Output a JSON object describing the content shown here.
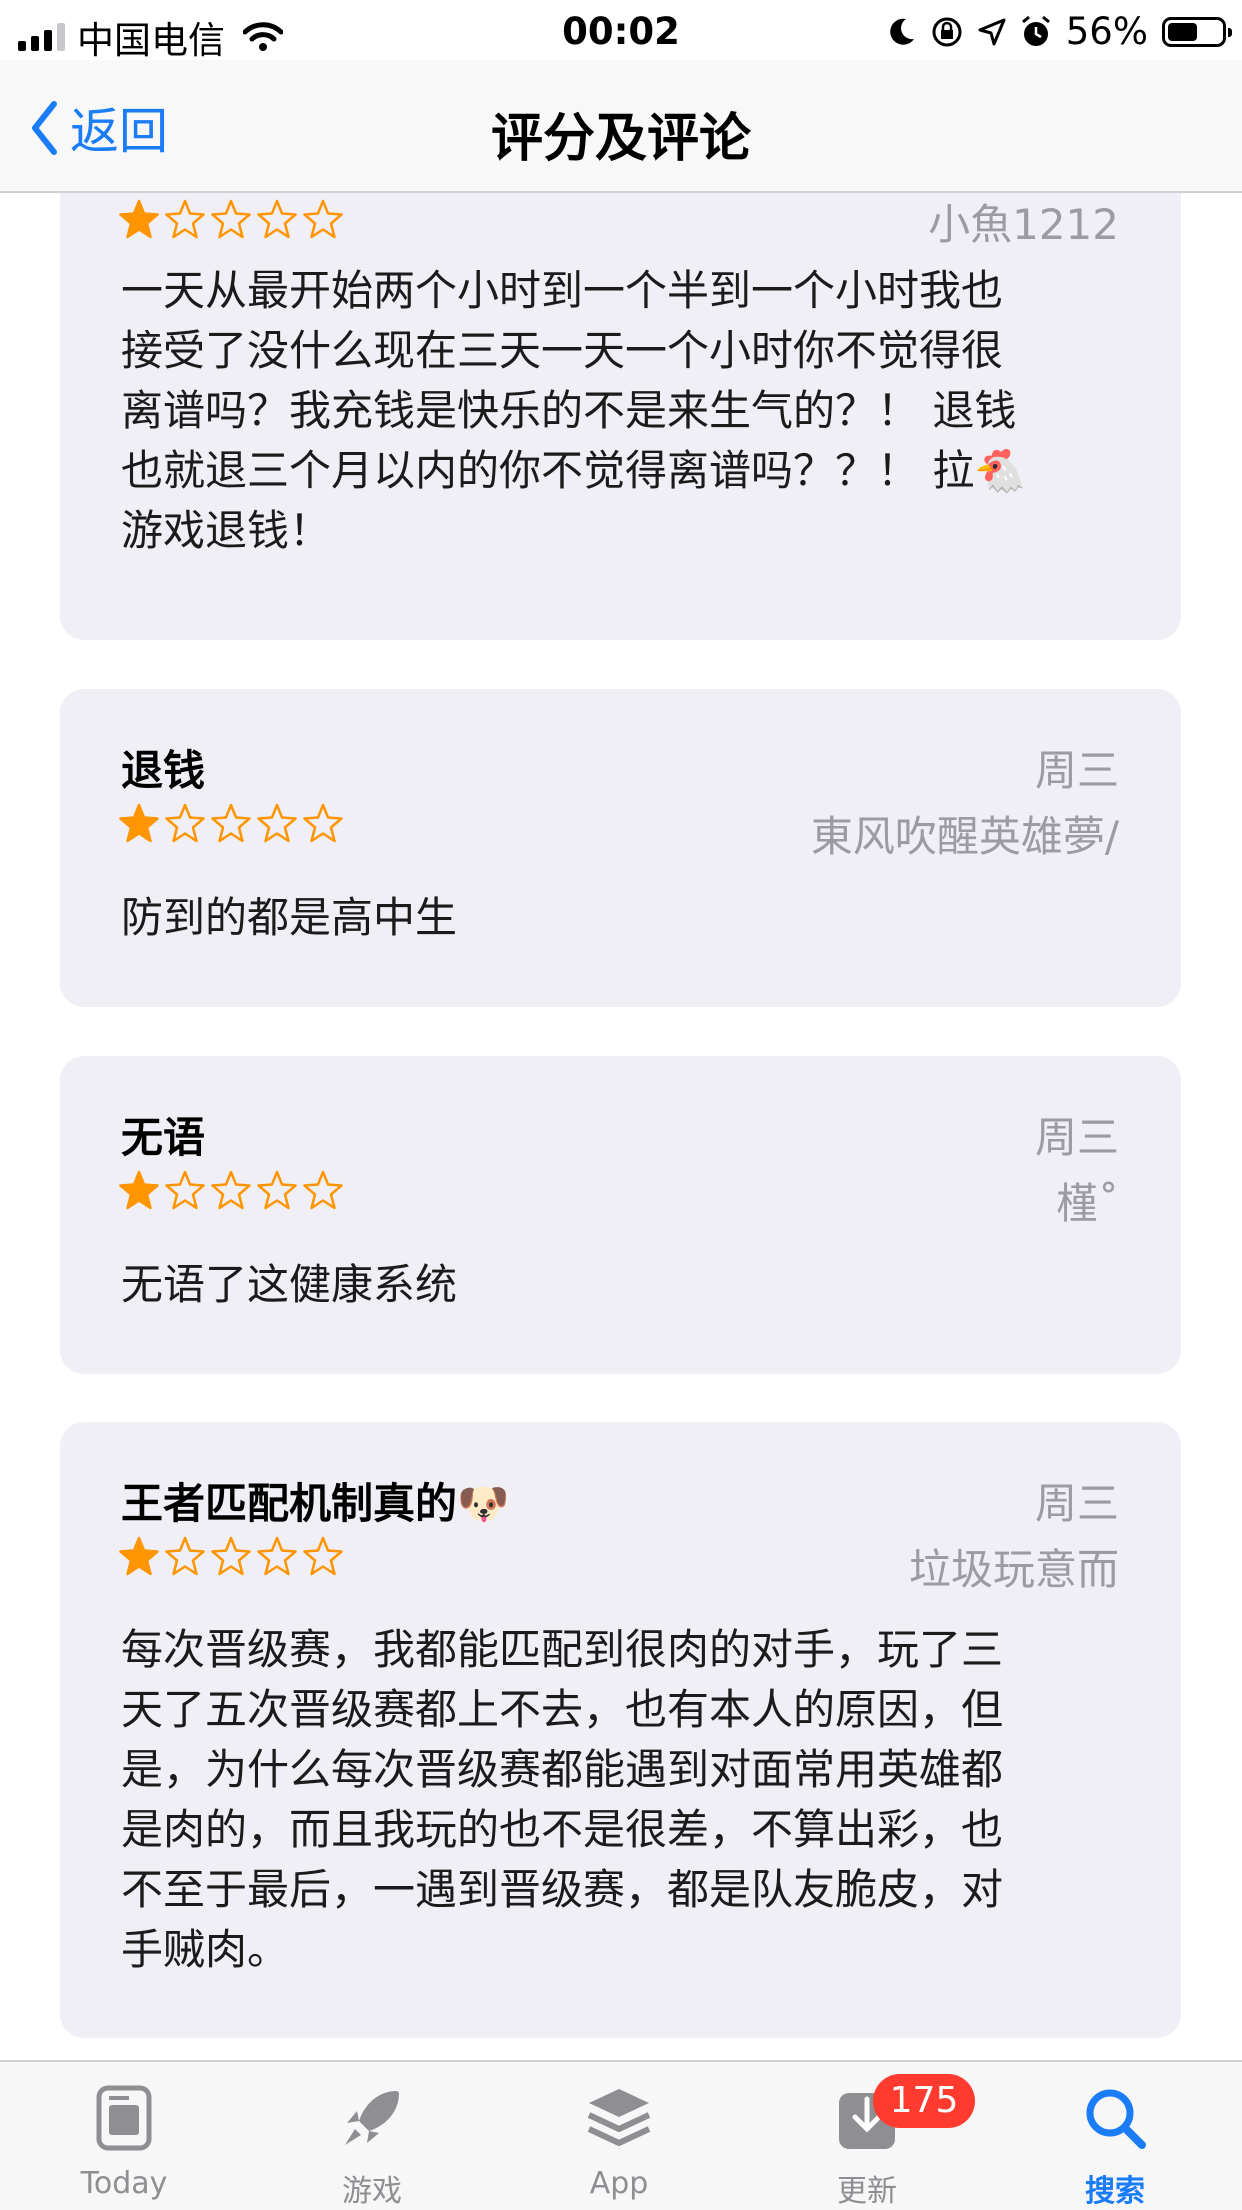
{
  "status_bar": {
    "carrier": "中国电信",
    "time": "00:02",
    "battery": "56%",
    "battery_level": 0.56
  },
  "nav": {
    "back_label": "返回",
    "title": "评分及评论"
  },
  "reviews": [
    {
      "title": "",
      "date": "",
      "author": "小魚1212",
      "rating": 1,
      "lines": [
        "一天从最开始两个小时到一个半到一个小时我也",
        "接受了没什么现在三天一天一个小时你不觉得很",
        "离谱吗？我充钱是快乐的不是来生气的？！ 退钱",
        "也就退三个月以内的你不觉得离谱吗？？！ 拉🐔",
        "游戏退钱！"
      ]
    },
    {
      "title": "退钱",
      "date": "周三",
      "author": "東风吹醒英雄夢/",
      "rating": 1,
      "lines": [
        "防到的都是高中生"
      ]
    },
    {
      "title": "无语",
      "date": "周三",
      "author": "槿˚",
      "rating": 1,
      "lines": [
        "无语了这健康系统"
      ]
    },
    {
      "title": "王者匹配机制真的🐶",
      "date": "周三",
      "author": "垃圾玩意而",
      "rating": 1,
      "lines": [
        "每次晋级赛，我都能匹配到很肉的对手，玩了三",
        "天了五次晋级赛都上不去，也有本人的原因，但",
        "是，为什么每次晋级赛都能遇到对面常用英雄都",
        "是肉的，而且我玩的也不是很差，不算出彩，也",
        "不至于最后，一遇到晋级赛，都是队友脆皮，对",
        "手贼肉。"
      ]
    }
  ],
  "tabbar": {
    "tabs": [
      {
        "label": "Today",
        "icon": "today-icon"
      },
      {
        "label": "游戏",
        "icon": "rocket-icon"
      },
      {
        "label": "App",
        "icon": "layers-icon"
      },
      {
        "label": "更新",
        "icon": "download-icon",
        "badge": "175"
      },
      {
        "label": "搜索",
        "icon": "search-icon",
        "active": true
      }
    ]
  },
  "colors": {
    "accent": "#1a7cf6",
    "star": "#ff9500",
    "card_bg": "#efeff5",
    "badge": "#ff3b30"
  }
}
